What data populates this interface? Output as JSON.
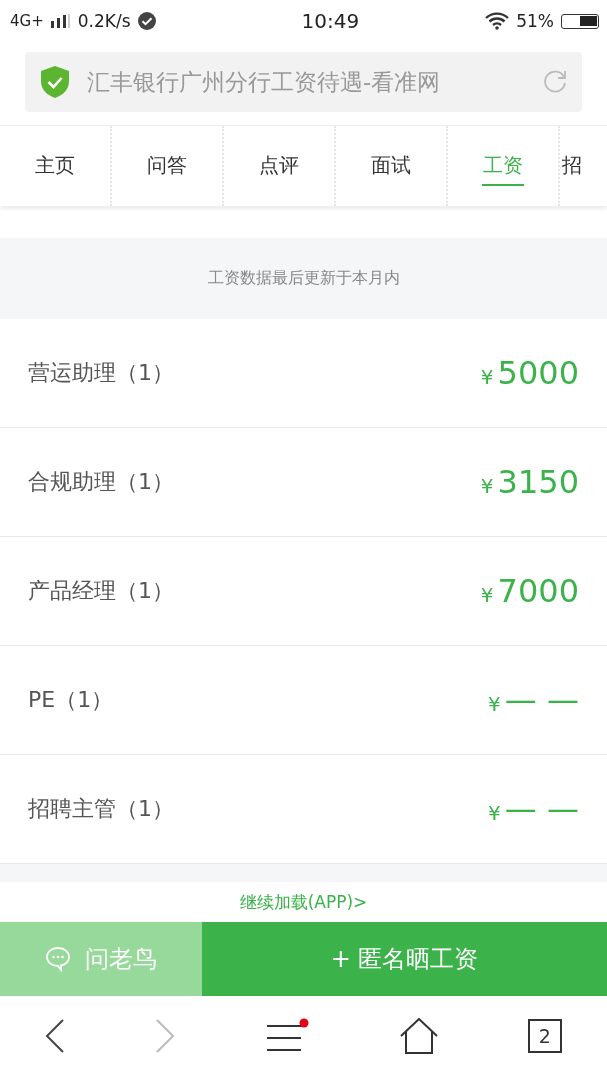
{
  "status_bar": {
    "network": "4G+",
    "speed": "0.2K/s",
    "time": "10:49",
    "battery": "51%"
  },
  "address_bar": {
    "title": "汇丰银行广州分行工资待遇-看准网"
  },
  "tabs": [
    {
      "label": "主页",
      "selected": false
    },
    {
      "label": "问答",
      "selected": false
    },
    {
      "label": "点评",
      "selected": false
    },
    {
      "label": "面试",
      "selected": false
    },
    {
      "label": "工资",
      "selected": true
    },
    {
      "label": "招",
      "selected": false
    }
  ],
  "update_note": "工资数据最后更新于本月内",
  "salaries": [
    {
      "title": "营运助理（1）",
      "currency": "¥",
      "amount": "5000"
    },
    {
      "title": "合规助理（1）",
      "currency": "¥",
      "amount": "3150"
    },
    {
      "title": "产品经理（1）",
      "currency": "¥",
      "amount": "7000"
    },
    {
      "title": "PE（1）",
      "currency": "¥",
      "amount": "— —"
    },
    {
      "title": "招聘主管（1）",
      "currency": "¥",
      "amount": "— —"
    }
  ],
  "load_more": "继续加载(APP)>",
  "actions": [
    {
      "label": "问老鸟",
      "kind": "ask"
    },
    {
      "label": "+ 匿名晒工资",
      "kind": "share"
    }
  ],
  "browser_nav": {
    "tab_count": "2",
    "menu_badge": true
  }
}
